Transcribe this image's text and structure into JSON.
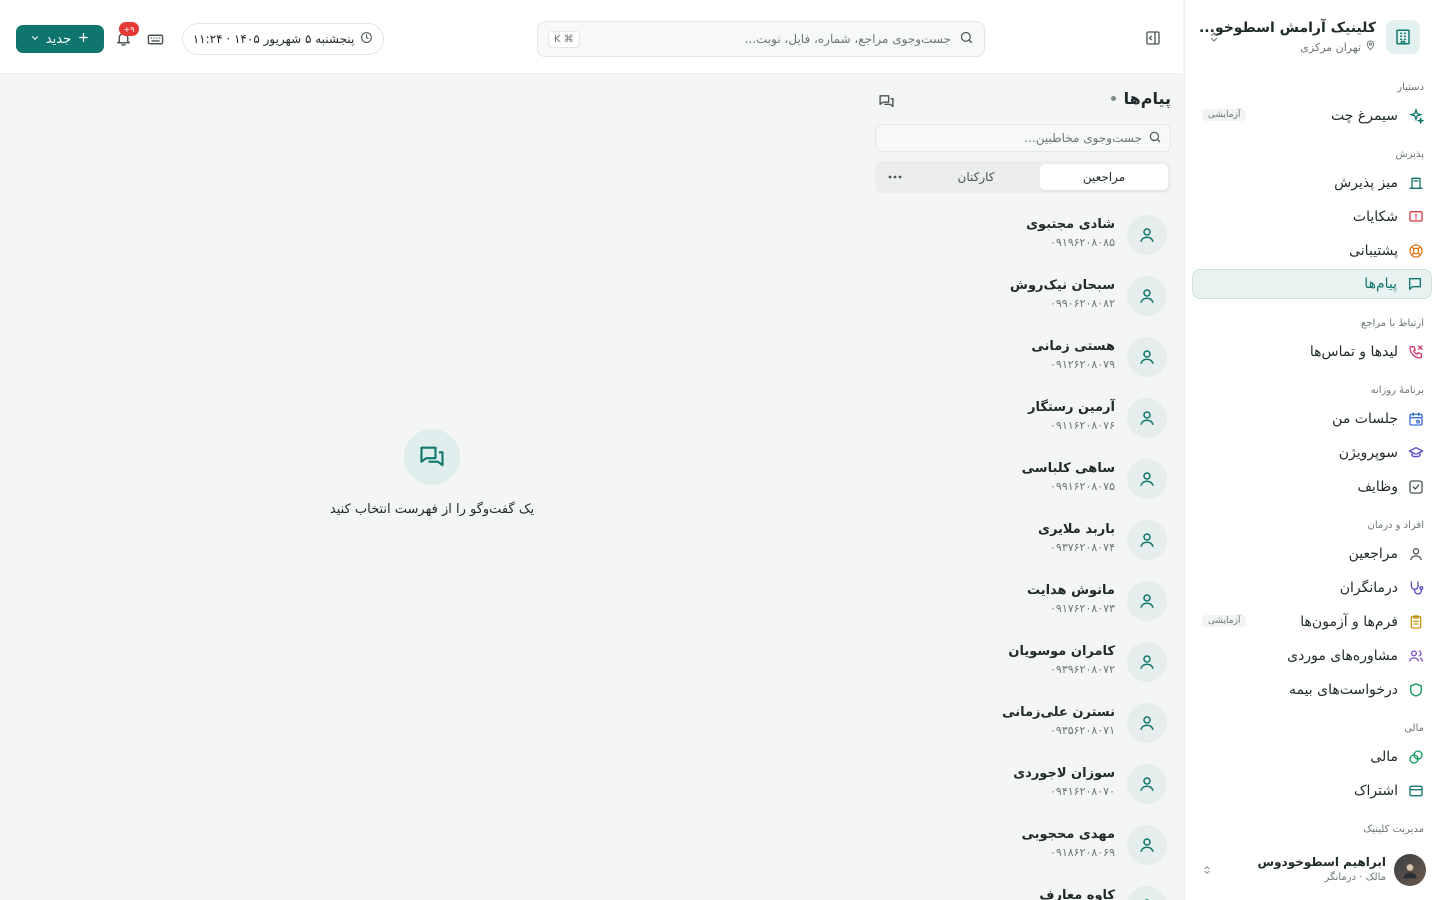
{
  "clinic": {
    "name": "کلینیک آرامش اسطوخو...",
    "location": "تهران مرکزی"
  },
  "sidebar": {
    "sections": {
      "assistant": "دستیار",
      "reception": "پذیرش",
      "client_relations": "ارتباط با مراجع",
      "daily_program": "برنامهٔ روزانه",
      "people_treatment": "افراد و درمان",
      "finance": "مالی",
      "clinic_management": "مدیریت کلینیک"
    },
    "trial_badge": "آزمایشی",
    "items": [
      {
        "label": "سیمرغ چت"
      },
      {
        "label": "میز پذیرش"
      },
      {
        "label": "شکایات"
      },
      {
        "label": "پشتیبانی"
      },
      {
        "label": "پیام‌ها"
      },
      {
        "label": "لیدها و تماس‌ها"
      },
      {
        "label": "جلسات من"
      },
      {
        "label": "سوپرویژن"
      },
      {
        "label": "وظایف"
      },
      {
        "label": "مراجعین"
      },
      {
        "label": "درمانگران"
      },
      {
        "label": "فرم‌ها و آزمون‌ها"
      },
      {
        "label": "مشاوره‌های موردی"
      },
      {
        "label": "درخواست‌های بیمه"
      },
      {
        "label": "مالی"
      },
      {
        "label": "اشتراک"
      }
    ]
  },
  "user": {
    "name": "ابراهیم اسطوخودوس",
    "role": "مالک · درمانگر"
  },
  "topbar": {
    "search_placeholder": "جست‌وجوی مراجع، شماره، فایل، نوبت...",
    "shortcut": "⌘ K",
    "datetime": "پنجشنبه ۵ شهریور ۱۴۰۵ · ۱۱:۲۴",
    "notif_count": "۹+",
    "new_label": "جدید"
  },
  "messages": {
    "title": "پیام‌ها",
    "search_placeholder": "جست‌وجوی مخاطبین...",
    "tabs": [
      "مراجعین",
      "کارکنان"
    ],
    "contacts": [
      {
        "name": "شادی مجتبوی",
        "phone": "۰۹۱۹۶۲۰۸۰۸۵"
      },
      {
        "name": "سبحان نیک‌روش",
        "phone": "۰۹۹۰۶۲۰۸۰۸۲"
      },
      {
        "name": "هستی زمانی",
        "phone": "۰۹۱۲۶۲۰۸۰۷۹"
      },
      {
        "name": "آرمین رستگار",
        "phone": "۰۹۱۱۶۲۰۸۰۷۶"
      },
      {
        "name": "ساهی کلباسی",
        "phone": "۰۹۹۱۶۲۰۸۰۷۵"
      },
      {
        "name": "باربد ملایری",
        "phone": "۰۹۳۷۶۲۰۸۰۷۴"
      },
      {
        "name": "مانوش هدایت",
        "phone": "۰۹۱۷۶۲۰۸۰۷۳"
      },
      {
        "name": "کامران موسویان",
        "phone": "۰۹۳۹۶۲۰۸۰۷۲"
      },
      {
        "name": "نسترن علی‌زمانی",
        "phone": "۰۹۳۵۶۲۰۸۰۷۱"
      },
      {
        "name": "سوزان لاجوردی",
        "phone": "۰۹۴۱۶۲۰۸۰۷۰"
      },
      {
        "name": "مهدی محجوبی",
        "phone": "۰۹۱۸۶۲۰۸۰۶۹"
      },
      {
        "name": "کاوه معارف",
        "phone": ""
      }
    ]
  },
  "empty_state": {
    "text": "یک گفت‌وگو را از فهرست انتخاب کنید"
  },
  "colors": {
    "accent": "#0f766e",
    "accent_light": "#e7f2f1",
    "badge_red": "#e53935"
  },
  "icons": {
    "sidebar": [
      "sparkles-icon",
      "desk-icon",
      "alert-icon",
      "lifebuoy-icon",
      "message-icon",
      "phone-missed-icon",
      "calendar-icon",
      "graduation-cap-icon",
      "checkbox-icon",
      "user-icon",
      "stethoscope-icon",
      "clipboard-icon",
      "users-icon",
      "shield-icon",
      "coins-icon",
      "credit-card-icon"
    ]
  }
}
